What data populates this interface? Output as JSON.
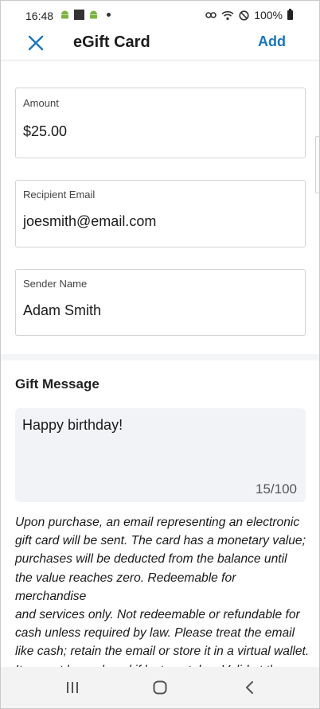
{
  "status_bar": {
    "time": "16:48",
    "battery": "100%"
  },
  "app_bar": {
    "title": "eGift Card",
    "add_label": "Add",
    "accent_color": "#1976c0"
  },
  "form": {
    "amount": {
      "label": "Amount",
      "value": "$25.00"
    },
    "recipient_email": {
      "label": "Recipient Email",
      "value": "joesmith@email.com"
    },
    "sender_name": {
      "label": "Sender Name",
      "value": "Adam Smith"
    }
  },
  "gift_message": {
    "title": "Gift Message",
    "text": "Happy birthday!",
    "counter": "15/100"
  },
  "terms": {
    "lines": [
      "Upon purchase, an email representing an electronic",
      "gift card will be sent. The card has a monetary value;",
      "purchases will be deducted from the balance until",
      "the value reaches zero. Redeemable for merchandise",
      "and services only. Not redeemable or refundable for",
      "cash unless required by law. Please treat the email",
      "like cash; retain the email or store it in a virtual wallet.",
      "It cannot be replaced if lost or stolen. Valid at the"
    ]
  },
  "icons": {
    "close": "close-icon",
    "recents": "recents-icon",
    "home": "home-icon",
    "back": "back-icon"
  }
}
